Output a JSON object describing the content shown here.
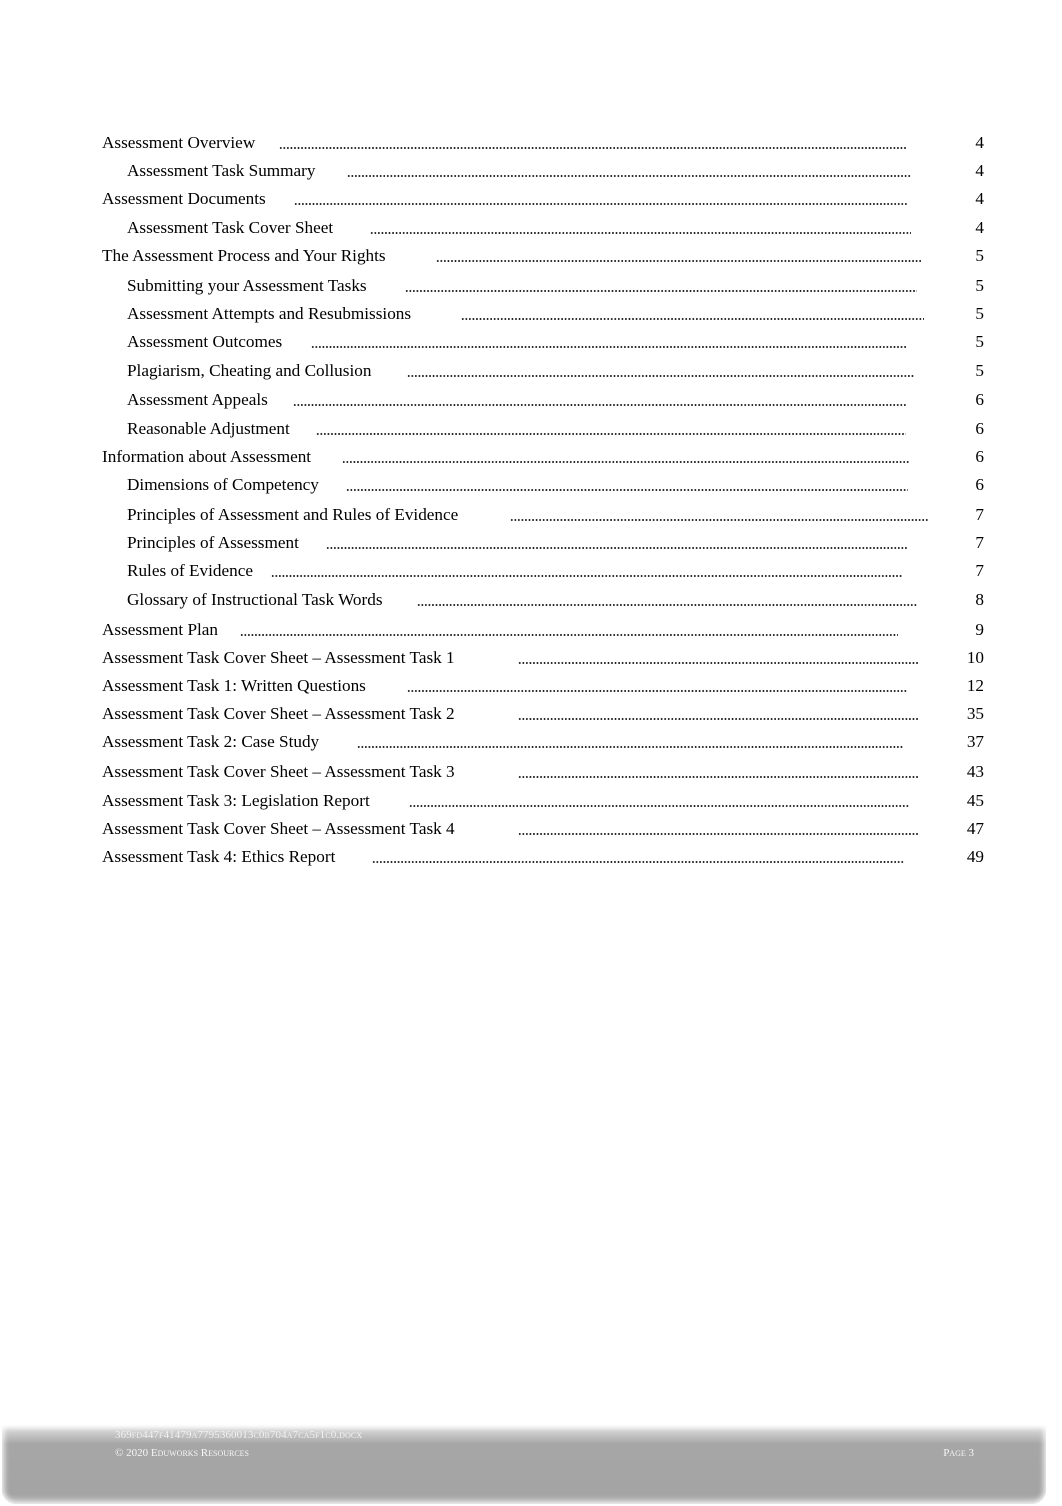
{
  "toc": {
    "entries": [
      {
        "level": 1,
        "title": "Assessment Overview",
        "page": "4"
      },
      {
        "level": 2,
        "title": "Assessment Task Summary",
        "page": "4"
      },
      {
        "level": 1,
        "title": "Assessment Documents",
        "page": "4"
      },
      {
        "level": 2,
        "title": "Assessment Task Cover Sheet",
        "page": "4"
      },
      {
        "level": 1,
        "title": "The Assessment Process and Your Rights",
        "page": "5"
      },
      {
        "level": 2,
        "title": "Submitting your Assessment Tasks",
        "page": "5"
      },
      {
        "level": 2,
        "title": "Assessment Attempts and Resubmissions",
        "page": "5"
      },
      {
        "level": 2,
        "title": "Assessment Outcomes",
        "page": "5"
      },
      {
        "level": 2,
        "title": "Plagiarism, Cheating and Collusion",
        "page": "5"
      },
      {
        "level": 2,
        "title": "Assessment Appeals",
        "page": "6"
      },
      {
        "level": 2,
        "title": "Reasonable Adjustment",
        "page": "6"
      },
      {
        "level": 1,
        "title": "Information about Assessment",
        "page": "6"
      },
      {
        "level": 2,
        "title": "Dimensions of Competency",
        "page": "6"
      },
      {
        "level": 2,
        "title": "Principles of Assessment and Rules of Evidence",
        "page": "7"
      },
      {
        "level": 2,
        "title": "Principles of Assessment",
        "page": "7"
      },
      {
        "level": 2,
        "title": "Rules of Evidence",
        "page": "7"
      },
      {
        "level": 2,
        "title": "Glossary of Instructional Task Words",
        "page": "8"
      },
      {
        "level": 1,
        "title": "Assessment Plan",
        "page": "9"
      },
      {
        "level": 1,
        "title": "Assessment Task Cover Sheet – Assessment Task 1",
        "page": "10"
      },
      {
        "level": 1,
        "title": "Assessment Task 1: Written Questions",
        "page": "12"
      },
      {
        "level": 1,
        "title": "Assessment Task Cover Sheet – Assessment Task 2",
        "page": "35"
      },
      {
        "level": 1,
        "title": "Assessment Task 2: Case Study",
        "page": "37"
      },
      {
        "level": 1,
        "title": "Assessment Task Cover Sheet – Assessment Task 3",
        "page": "43"
      },
      {
        "level": 1,
        "title": "Assessment Task 3: Legislation Report",
        "page": "45"
      },
      {
        "level": 1,
        "title": "Assessment Task Cover Sheet – Assessment Task 4",
        "page": "47"
      },
      {
        "level": 1,
        "title": "Assessment Task 4: Ethics Report",
        "page": "49"
      }
    ]
  },
  "footer": {
    "document_name": "369fd447f41479a7795360013c0b704a7ca5f1c0.docx",
    "copyright": "© 2020 Eduworks Resources",
    "page_label": "Page 3"
  }
}
